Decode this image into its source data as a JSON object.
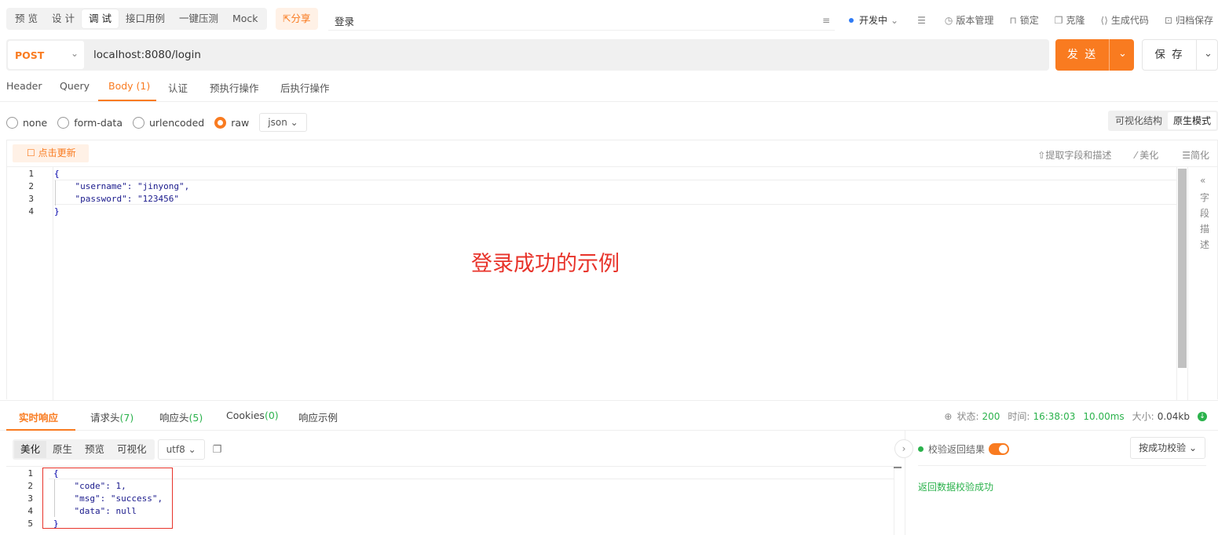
{
  "mode_tabs": [
    "预 览",
    "设 计",
    "调 试",
    "接口用例",
    "一键压测",
    "Mock"
  ],
  "share_label": "分享",
  "api_name": "登录",
  "top_right": {
    "env": "开发中",
    "version": "版本管理",
    "lock": "锁定",
    "clone": "克隆",
    "gen_code": "生成代码",
    "archive": "归档保存"
  },
  "request": {
    "method": "POST",
    "url": "localhost:8080/login",
    "send_label": "发 送",
    "save_label": "保 存"
  },
  "req_tabs": [
    "Header",
    "Query",
    "Body (1)",
    "认证",
    "预执行操作",
    "后执行操作"
  ],
  "body_types": [
    "none",
    "form-data",
    "urlencoded",
    "raw"
  ],
  "body_format": "json",
  "view_modes": [
    "可视化结构",
    "原生模式"
  ],
  "editor_toolbar": {
    "update": "点击更新",
    "extract": "提取字段和描述",
    "beautify": "美化",
    "simplify": "简化"
  },
  "request_body_lines": [
    "{",
    "    \"username\": \"jinyong\",",
    "    \"password\": \"123456\"",
    "}"
  ],
  "field_panel": [
    "«",
    "字",
    "段",
    "描",
    "述"
  ],
  "annotation": "登录成功的示例",
  "resp_tabs": {
    "realtime": "实时响应",
    "req_headers": "请求头",
    "req_headers_count": "(7)",
    "resp_headers": "响应头",
    "resp_headers_count": "(5)",
    "cookies": "Cookies",
    "cookies_count": "(0)",
    "example": "响应示例"
  },
  "status": {
    "status_label": "状态:",
    "status_value": "200",
    "time_label": "时间:",
    "time_value": "16:38:03",
    "duration": "10.00ms",
    "size_label": "大小:",
    "size_value": "0.04kb"
  },
  "resp_view": [
    "美化",
    "原生",
    "预览",
    "可视化"
  ],
  "encoding": "utf8",
  "response_lines": [
    "{",
    "    \"code\": 1,",
    "    \"msg\": \"success\",",
    "    \"data\": null",
    "}"
  ],
  "validation": {
    "title": "校验返回结果",
    "mode": "按成功校验",
    "result": "返回数据校验成功"
  },
  "colors": {
    "accent": "#f97b20",
    "success": "#2bb24c",
    "annotation": "#e8332a"
  }
}
